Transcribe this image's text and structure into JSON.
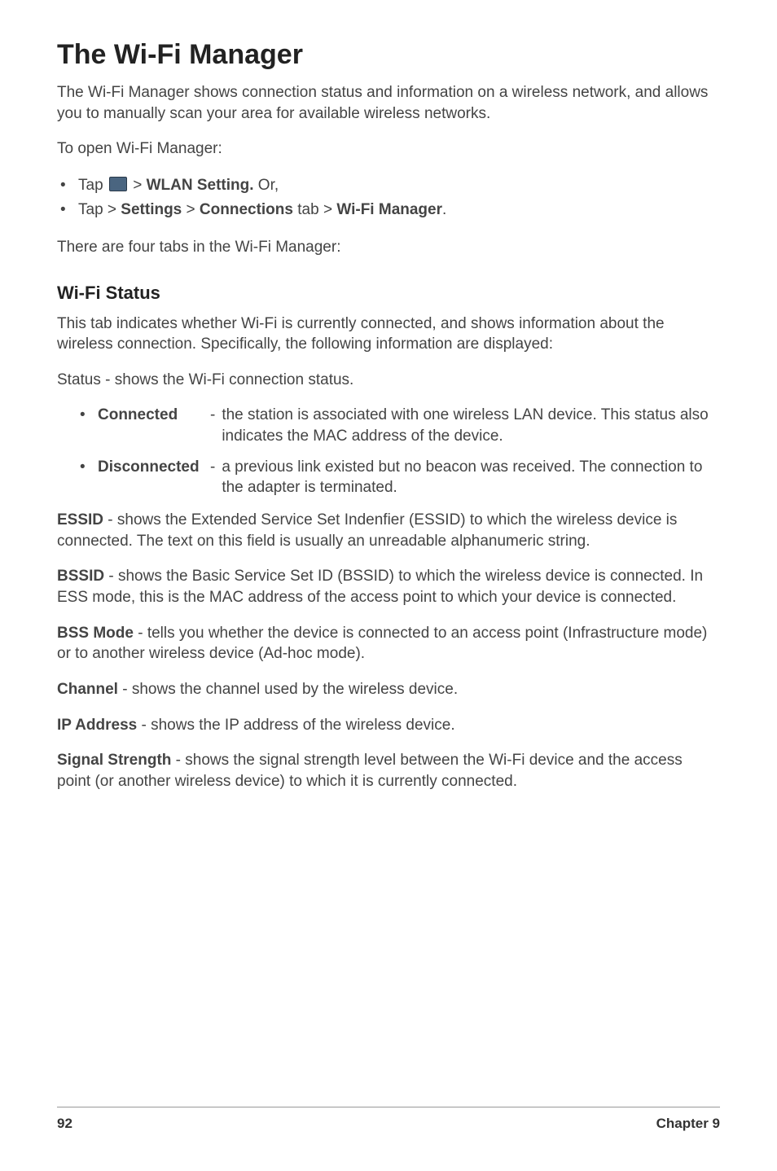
{
  "heading": "The Wi-Fi Manager",
  "intro": "The Wi-Fi Manager shows connection status and information on a wireless network, and allows you to manually scan your area for available wireless networks.",
  "open_lead": "To open Wi-Fi Manager:",
  "step1_tap": "Tap ",
  "step1_gt": " > ",
  "step1_bold": "WLAN Setting.",
  "step1_or": " Or,",
  "step2_tap": "Tap  > ",
  "step2_settings": "Settings",
  "step2_gt1": " > ",
  "step2_connections": "Connections",
  "step2_tab": " tab > ",
  "step2_wifi": "Wi-Fi Manager",
  "step2_period": ".",
  "four_tabs": "There are four tabs in the Wi-Fi Manager:",
  "wifi_status_heading": "Wi-Fi Status",
  "wifi_status_intro": "This tab indicates whether Wi-Fi is currently connected, and shows information about the wireless connection. Specifically, the following information are displayed:",
  "status_line": "Status - shows the Wi-Fi connection status.",
  "connected_term": "Connected",
  "connected_sep": "-",
  "connected_desc": "the station is associated with one wireless LAN device. This status also indicates the MAC address of the device.",
  "disconnected_term": "Disconnected",
  "disconnected_sep": "-",
  "disconnected_desc": "a previous link existed but no beacon was received. The connection to the adapter is terminated.",
  "essid_bold": "ESSID",
  "essid_text": " - shows the Extended Service Set Indenfier (ESSID) to which the wireless device is connected. The text on this field is usually an unreadable alphanumeric string.",
  "bssid_bold": "BSSID",
  "bssid_text": " - shows the Basic Service Set ID (BSSID) to which the wireless device is connected. In ESS mode, this is the MAC address of the access point to which your device is connected.",
  "bssmode_bold": "BSS Mode",
  "bssmode_text": " - tells you whether the device is connected to an access point (Infrastructure mode) or to another wireless device (Ad-hoc mode).",
  "channel_bold": "Channel",
  "channel_text": " - shows the channel used by the wireless device.",
  "ip_bold": "IP Address",
  "ip_text": " - shows the IP address of the wireless device.",
  "signal_bold": "Signal Strength",
  "signal_text": " - shows the signal strength level between the Wi-Fi device and the access point (or another wireless device) to which it is currently connected.",
  "page_num": "92",
  "chapter": "Chapter 9"
}
